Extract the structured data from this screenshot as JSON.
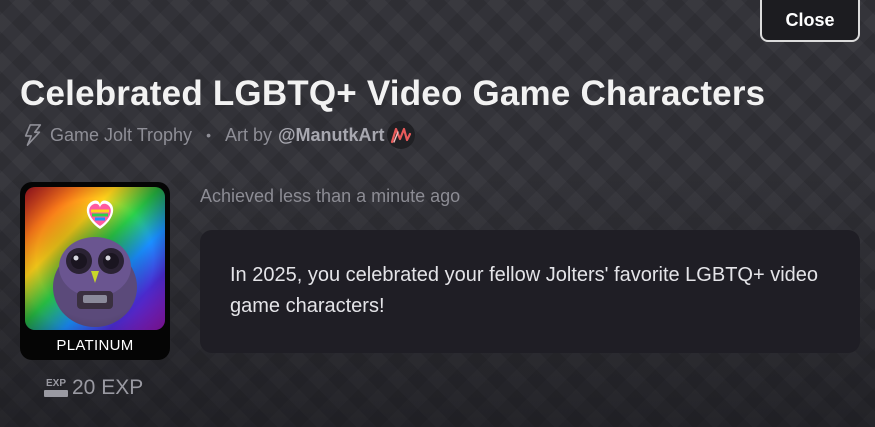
{
  "modal": {
    "close_label": "Close"
  },
  "trophy": {
    "title": "Celebrated LGBTQ+ Video Game Characters",
    "source": "Game Jolt Trophy",
    "art_by_prefix": "Art by",
    "artist_handle": "@ManutkArt",
    "tier": "PLATINUM",
    "exp_icon_text": "EXP",
    "exp_value": "20 EXP",
    "achieved": "Achieved less than a minute ago",
    "description": "In 2025, you celebrated your fellow Jolters' favorite LGBTQ+ video game characters!"
  },
  "icons": {
    "bolt": "game-jolt-bolt-icon",
    "exp": "exp-icon",
    "artist_avatar": "artist-avatar",
    "heart": "rainbow-heart-icon"
  },
  "colors": {
    "background": "#303036",
    "panel": "#1f1e25",
    "title": "#f2f2f2",
    "muted": "#8f8f97"
  }
}
